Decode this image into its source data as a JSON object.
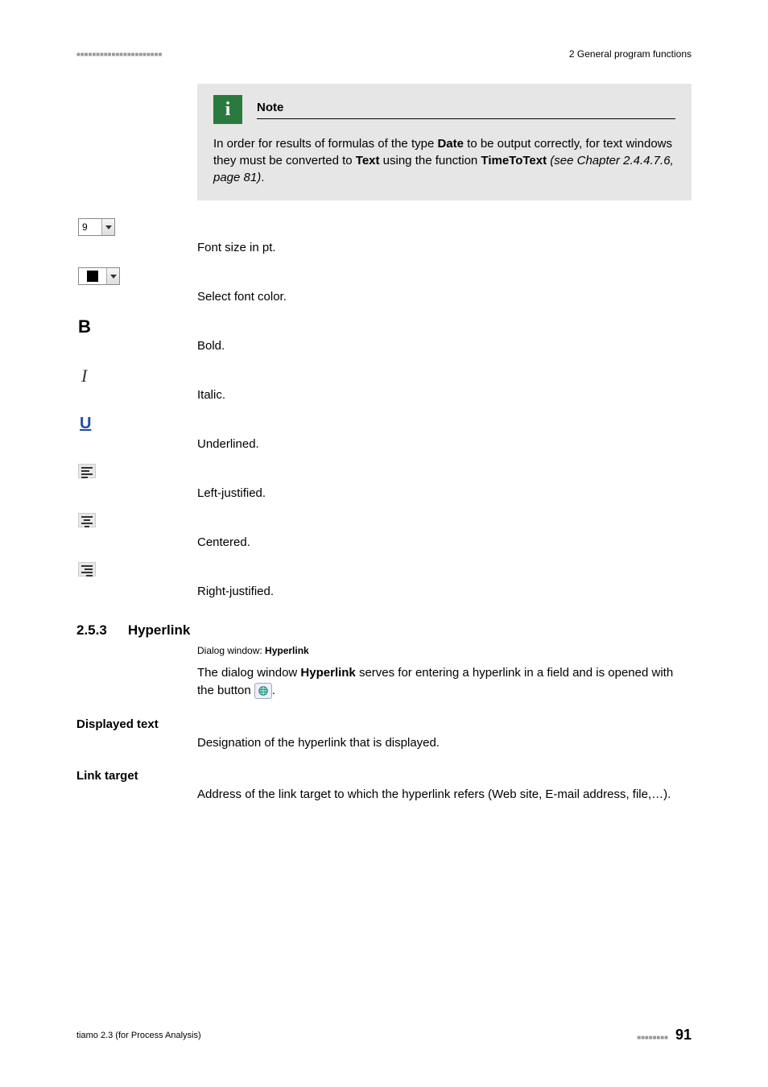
{
  "header": {
    "dashes": "■■■■■■■■■■■■■■■■■■■■■■",
    "section": "2 General program functions"
  },
  "note": {
    "title": "Note",
    "body_parts": {
      "p1": "In order for results of formulas of the type ",
      "b1": "Date",
      "p2": " to be output correctly, for text windows they must be converted to ",
      "b2": "Text",
      "p3": " using the function ",
      "b3": "TimeToText",
      "it": " (see Chapter 2.4.4.7.6, page 81)",
      "p4": "."
    }
  },
  "items": {
    "font_size_val": "9",
    "font_size": "Font size in pt.",
    "font_color": "Select font color.",
    "bold": "Bold.",
    "italic": "Italic.",
    "underline": "Underlined.",
    "left": "Left-justified.",
    "center": "Centered.",
    "right": "Right-justified."
  },
  "hyperlink_section": {
    "num": "2.5.3",
    "title": "Hyperlink",
    "dialog_prefix": "Dialog window: ",
    "dialog_name": "Hyperlink",
    "para1a": "The dialog window ",
    "para1b": "Hyperlink",
    "para1c": " serves for entering a hyperlink in a field and is opened with the button ",
    "para1d": ".",
    "displayed_text_label": "Displayed text",
    "displayed_text_desc": "Designation of the hyperlink that is displayed.",
    "link_target_label": "Link target",
    "link_target_desc": "Address of the link target to which the hyperlink refers (Web site, E-mail address, file,…)."
  },
  "footer": {
    "product": "tiamo 2.3 (for Process Analysis)",
    "dashes": "■■■■■■■■",
    "page": "91"
  }
}
